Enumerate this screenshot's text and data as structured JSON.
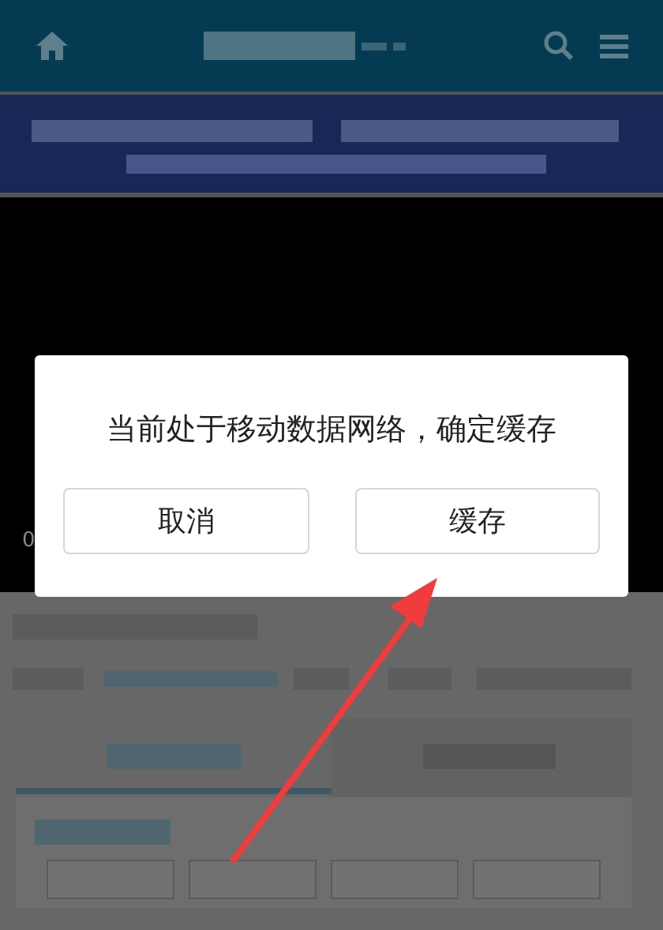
{
  "player": {
    "time": "0"
  },
  "dialog": {
    "message": "当前处于移动数据网络，确定缓存",
    "buttons": [
      {
        "label": "取消"
      },
      {
        "label": "缓存"
      }
    ]
  }
}
